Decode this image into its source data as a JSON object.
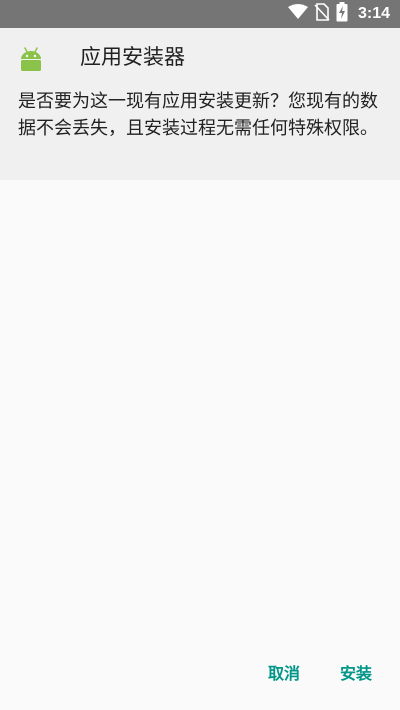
{
  "status_bar": {
    "time": "3:14",
    "icons": [
      "wifi-icon",
      "no-sim-icon",
      "battery-charging-icon"
    ]
  },
  "dialog": {
    "app_icon": "android-icon",
    "title": "应用安装器",
    "message": "是否要为这一现有应用安装更新？您现有的数据不会丢失，且安装过程无需任何特殊权限。",
    "cancel_label": "取消",
    "install_label": "安装"
  },
  "colors": {
    "status_bar": "#757575",
    "header_bg": "#f0f0f0",
    "accent": "#009688",
    "android_green": "#8bc34a"
  }
}
